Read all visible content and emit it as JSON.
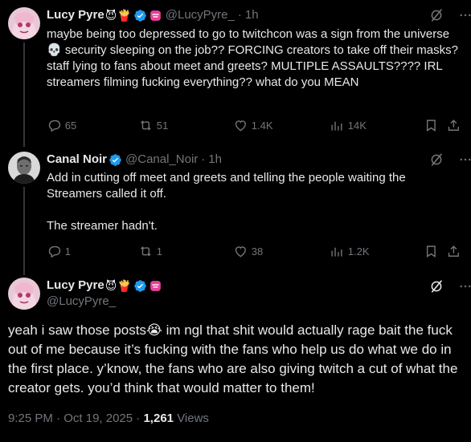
{
  "tweets": [
    {
      "name": "Lucy Pyre",
      "emojis": [
        "😈",
        "🍟"
      ],
      "handle": "@LucyPyre_",
      "sep": "·",
      "time": "1h",
      "text": "maybe being too depressed to go to twitchcon was a sign from the universe 💀 security sleeping on the job?? FORCING creators to take off their masks? staff lying to fans about meet and greets? MULTIPLE ASSAULTS???? IRL streamers filming fucking everything?? what do you MEAN",
      "replies": "65",
      "reposts": "51",
      "likes": "1.4K",
      "views": "14K"
    },
    {
      "name": "Canal Noir",
      "handle": "@Canal_Noir",
      "sep": "·",
      "time": "1h",
      "text": "Add in cutting off meet and greets and telling the people waiting the Streamers called it off.\n\nThe streamer hadn't.",
      "replies": "1",
      "reposts": "1",
      "likes": "38",
      "views": "1.2K"
    }
  ],
  "main": {
    "name": "Lucy Pyre",
    "emojis": [
      "😈",
      "🍟"
    ],
    "handle": "@LucyPyre_",
    "text": "yeah i saw those posts😭 im ngl that shit would actually rage bait the fuck out of me because it’s fucking with the fans who help us do what we do in the first place. y’know, the fans who are also giving twitch a cut of what the creator gets. you’d think that would matter to them!",
    "time": "9:25 PM",
    "date": "Oct 19, 2025",
    "views_count": "1,261",
    "views_label": "Views"
  },
  "icons": {
    "verified": "verified-badge-icon",
    "reply": "reply-icon",
    "repost": "repost-icon",
    "like": "heart-icon",
    "views": "views-icon",
    "bookmark": "bookmark-icon",
    "share": "share-icon",
    "grok": "grok-icon",
    "more": "more-icon",
    "affiliate": "affiliate-pink-icon"
  },
  "colors": {
    "verified": "#1d9bf0",
    "muted": "#71767b",
    "text": "#e7e9ea",
    "affiliate": "#e8409a"
  }
}
